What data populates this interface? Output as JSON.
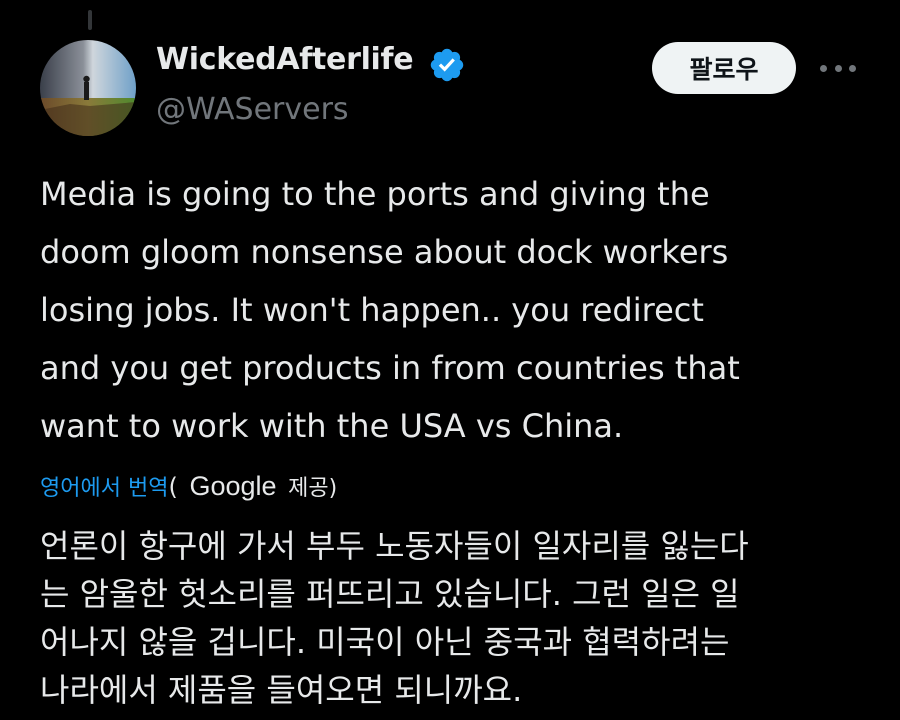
{
  "author": {
    "display_name": "WickedAfterlife",
    "handle": "@WAServers",
    "verified": true,
    "avatar_icon": "avatar-photo"
  },
  "actions": {
    "follow_label": "팔로우",
    "more_icon": "more-horizontal-icon"
  },
  "tweet": {
    "lines": [
      "Media is going to the ports and giving the",
      "doom gloom nonsense about dock workers",
      "losing jobs. It won't happen.. you redirect",
      "and you get products in from countries that",
      "want to work with the USA vs China."
    ]
  },
  "translation": {
    "link_label": "영어에서 번역",
    "paren_open": "(",
    "provider": "Google",
    "provided_suffix": "제공)",
    "lines": [
      "언론이 항구에 가서 부두 노동자들이 일자리를 잃는다",
      "는 암울한 헛소리를 퍼뜨리고 있습니다. 그런 일은 일",
      "어나지 않을 겁니다. 미국이 아닌 중국과 협력하려는",
      "나라에서 제품을 들여오면 되니까요."
    ]
  },
  "colors": {
    "background": "#000000",
    "text": "#e7e9ea",
    "secondary": "#71767b",
    "accent": "#1d9bf0",
    "follow_bg": "#eff3f4"
  }
}
